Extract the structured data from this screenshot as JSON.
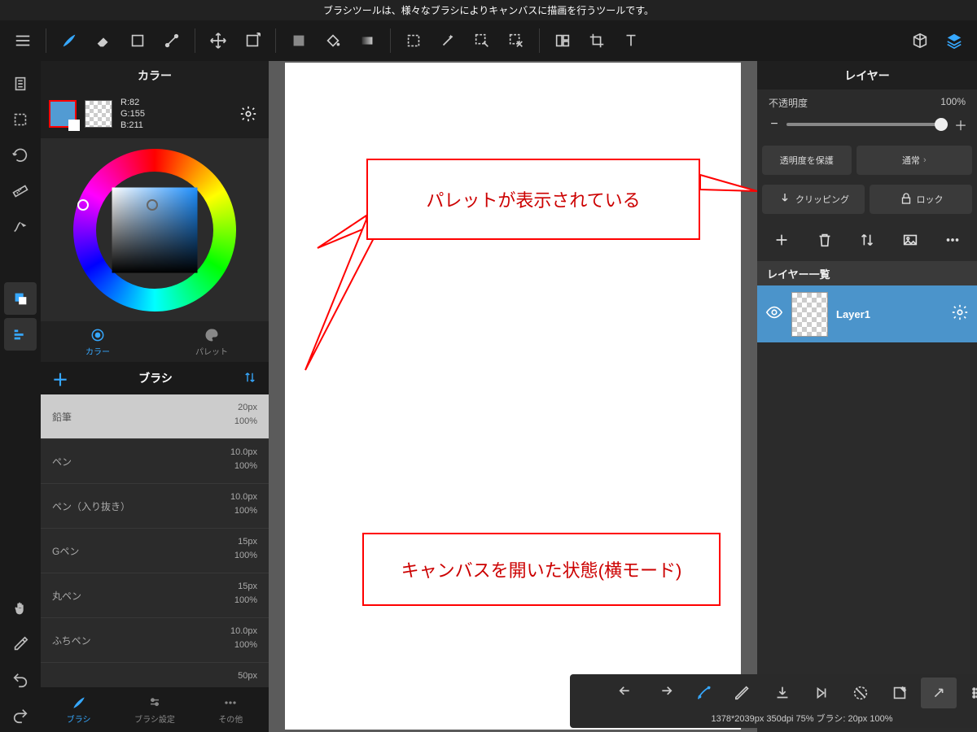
{
  "topinfo": "ブラシツールは、様々なブラシによりキャンバスに描画を行うツールです。",
  "panels": {
    "color_title": "カラー",
    "rgb_r": "R:82",
    "rgb_g": "G:155",
    "rgb_b": "B:211",
    "tab_color": "カラー",
    "tab_palette": "パレット",
    "brush_title": "ブラシ",
    "btab_brush": "ブラシ",
    "btab_settings": "ブラシ設定",
    "btab_other": "その他"
  },
  "brushes": [
    {
      "name": "鉛筆",
      "size": "20px",
      "op": "100%",
      "sel": true
    },
    {
      "name": "ペン",
      "size": "10.0px",
      "op": "100%",
      "sel": false
    },
    {
      "name": "ペン（入り抜き）",
      "size": "10.0px",
      "op": "100%",
      "sel": false
    },
    {
      "name": "Gペン",
      "size": "15px",
      "op": "100%",
      "sel": false
    },
    {
      "name": "丸ペン",
      "size": "15px",
      "op": "100%",
      "sel": false
    },
    {
      "name": "ふちペン",
      "size": "10.0px",
      "op": "100%",
      "sel": false
    },
    {
      "name": "",
      "size": "50px",
      "op": "",
      "sel": false
    }
  ],
  "layers": {
    "title": "レイヤー",
    "opacity_label": "不透明度",
    "opacity_value": "100%",
    "btn_protect": "透明度を保護",
    "btn_blend": "通常",
    "btn_clip": "クリッピング",
    "btn_lock": "ロック",
    "list_header": "レイヤー一覧",
    "items": [
      {
        "name": "Layer1"
      }
    ]
  },
  "annotations": {
    "callout1": "パレットが表示されている",
    "callout2": "キャンバスを開いた状態(横モード)"
  },
  "status": "1378*2039px 350dpi 75% ブラシ: 20px 100%"
}
